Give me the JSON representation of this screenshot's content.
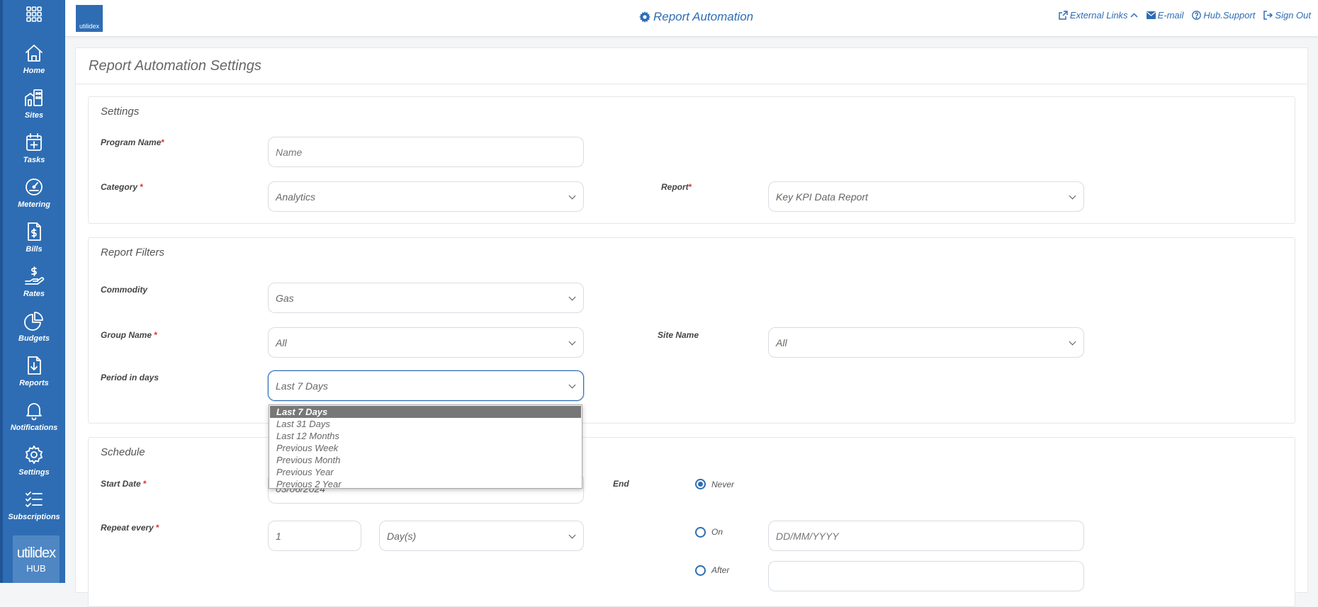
{
  "app": {
    "title": "Report Automation",
    "brand": "utilidex",
    "side_logo_line1": "utilidex",
    "side_logo_line2": "HUB"
  },
  "colors": {
    "primary": "#2e6db4",
    "required": "#d33333",
    "dropdown_selected": "#777777"
  },
  "sidebar": {
    "items": [
      {
        "label": "Home",
        "icon": "home-icon"
      },
      {
        "label": "Sites",
        "icon": "building-icon"
      },
      {
        "label": "Tasks",
        "icon": "calendar-plus-icon"
      },
      {
        "label": "Metering",
        "icon": "gauge-icon"
      },
      {
        "label": "Bills",
        "icon": "bill-icon"
      },
      {
        "label": "Rates",
        "icon": "hand-dollar-icon"
      },
      {
        "label": "Budgets",
        "icon": "pie-chart-icon"
      },
      {
        "label": "Reports",
        "icon": "download-file-icon"
      },
      {
        "label": "Notifications",
        "icon": "bell-icon"
      },
      {
        "label": "Settings",
        "icon": "gear-icon"
      },
      {
        "label": "Subscriptions",
        "icon": "checklist-icon"
      }
    ]
  },
  "header": {
    "links": {
      "external": "External Links",
      "email": "E-mail",
      "support": "Hub.Support",
      "signout": "Sign Out"
    }
  },
  "page": {
    "title": "Report Automation Settings"
  },
  "settings": {
    "title": "Settings",
    "program_name_label": "Program Name",
    "program_name_placeholder": "Name",
    "category_label": "Category ",
    "category_value": "Analytics",
    "report_label": "Report",
    "report_value": "Key KPI Data Report"
  },
  "filters": {
    "title": "Report Filters",
    "commodity_label": "Commodity",
    "commodity_value": "Gas",
    "group_label": "Group Name ",
    "group_value": "All",
    "site_label": "Site Name",
    "site_value": "All",
    "period_label": "Period in days",
    "period_value": "Last 7 Days",
    "period_options": [
      "Last 7 Days",
      "Last 31 Days",
      "Last 12 Months",
      "Previous Week",
      "Previous Month",
      "Previous Year",
      "Previous 2 Year"
    ]
  },
  "schedule": {
    "title": "Schedule",
    "start_label": "Start Date ",
    "start_value": "03/06/2024",
    "end_label": "End",
    "repeat_label": "Repeat every ",
    "repeat_value": "1",
    "repeat_unit": "Day(s)",
    "never_label": "Never",
    "on_label": "On",
    "on_placeholder": "DD/MM/YYYY",
    "after_label": "After"
  },
  "required_mark": "*"
}
